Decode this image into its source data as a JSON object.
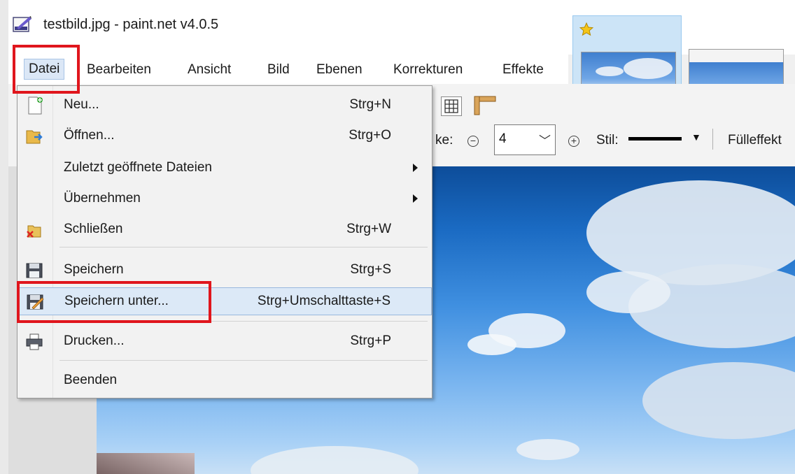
{
  "window": {
    "title": "testbild.jpg - paint.net v4.0.5"
  },
  "menubar": {
    "items": [
      {
        "label": "Datei",
        "active": true
      },
      {
        "label": "Bearbeiten"
      },
      {
        "label": "Ansicht"
      },
      {
        "label": "Bild"
      },
      {
        "label": "Ebenen"
      },
      {
        "label": "Korrekturen"
      },
      {
        "label": "Effekte"
      }
    ]
  },
  "toolbar": {
    "width_label_fragment": "ke:",
    "width_value": "4",
    "style_label": "Stil:",
    "fill_label": "Fülleffekt"
  },
  "file_menu": {
    "items": [
      {
        "label": "Neu...",
        "shortcut": "Strg+N",
        "icon": "new-file-icon"
      },
      {
        "label": "Öffnen...",
        "shortcut": "Strg+O",
        "icon": "open-folder-icon"
      },
      {
        "label": "Zuletzt geöffnete Dateien",
        "shortcut": "",
        "submenu": true
      },
      {
        "label": "Übernehmen",
        "shortcut": "",
        "submenu": true
      },
      {
        "label": "Schließen",
        "shortcut": "Strg+W",
        "icon": "close-file-icon"
      },
      {
        "label": "Speichern",
        "shortcut": "Strg+S",
        "icon": "save-disk-icon"
      },
      {
        "label": "Speichern unter...",
        "shortcut": "Strg+Umschalttaste+S",
        "icon": "save-as-disk-icon",
        "highlighted": true
      },
      {
        "label": "Drucken...",
        "shortcut": "Strg+P",
        "icon": "printer-icon"
      },
      {
        "label": "Beenden",
        "shortcut": ""
      }
    ]
  },
  "colors": {
    "annotation_red": "#e0161d",
    "menu_highlight": "#dce9f7",
    "thumbnail_selected": "#cce4f7"
  }
}
